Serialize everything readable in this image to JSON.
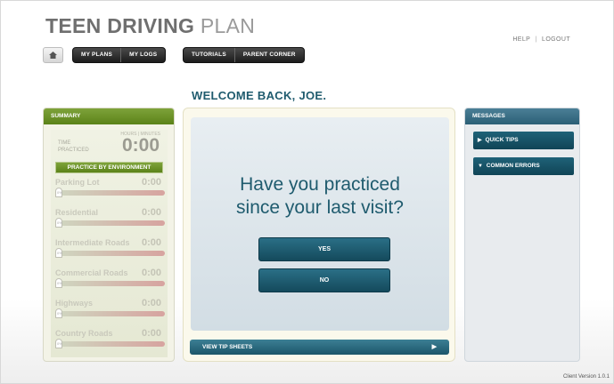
{
  "app": {
    "title_bold": "TEEN DRIVING",
    "title_light": "PLAN"
  },
  "top_links": {
    "help": "HELP",
    "separator": "|",
    "logout": "LOGOUT"
  },
  "nav": {
    "home_icon": "home-icon",
    "group1": [
      "MY PLANS",
      "MY LOGS"
    ],
    "group2": [
      "TUTORIALS",
      "PARENT CORNER"
    ]
  },
  "welcome": "WELCOME BACK, JOE.",
  "summary": {
    "header": "SUMMARY",
    "hours_minutes_label": "HOURS | MINUTES",
    "time_practiced_label_1": "TIME",
    "time_practiced_label_2": "PRACTICED",
    "time_practiced_value": "0:00",
    "env_header": "PRACTICE BY ENVIRONMENT",
    "environments": [
      {
        "name": "Parking Lot",
        "value": "0:00",
        "pct_label": "0%",
        "progress": 0
      },
      {
        "name": "Residential",
        "value": "0:00",
        "pct_label": "0%",
        "progress": 0
      },
      {
        "name": "Intermediate Roads",
        "value": "0:00",
        "pct_label": "0%",
        "progress": 0
      },
      {
        "name": "Commercial Roads",
        "value": "0:00",
        "pct_label": "0%",
        "progress": 0
      },
      {
        "name": "Highways",
        "value": "0:00",
        "pct_label": "0%",
        "progress": 0
      },
      {
        "name": "Country Roads",
        "value": "0:00",
        "pct_label": "0%",
        "progress": 0
      }
    ]
  },
  "center": {
    "question_line1": "Have you practiced",
    "question_line2": "since your last visit?",
    "yes_label": "YES",
    "no_label": "NO",
    "tip_sheets_label": "VIEW TIP SHEETS",
    "tip_arrow": "▶"
  },
  "messages": {
    "header": "MESSAGES",
    "items": [
      {
        "label": "QUICK TIPS",
        "marker": "▶"
      },
      {
        "label": "COMMON ERRORS",
        "marker": "▼"
      }
    ]
  },
  "version": "Client Version 1.0.1",
  "colors": {
    "accent_teal": "#1f5b6e",
    "summary_green": "#6b9128",
    "nav_dark": "#2a2a2a"
  }
}
